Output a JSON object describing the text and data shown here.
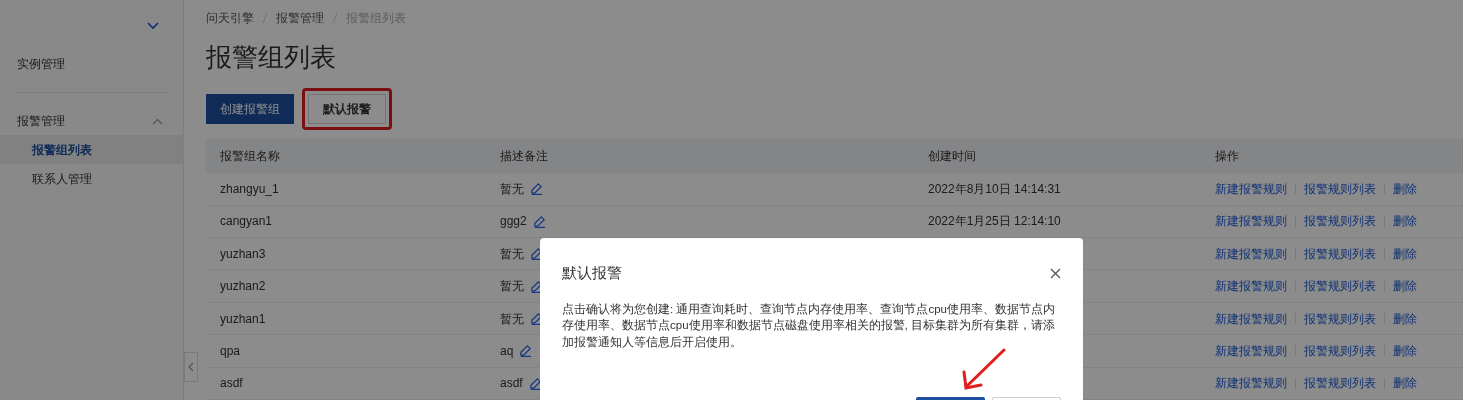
{
  "sidebar": {
    "items": [
      {
        "label": "实例管理",
        "kind": "item",
        "selected": false
      },
      {
        "label": "报警管理",
        "kind": "group",
        "expanded": true,
        "children": [
          {
            "label": "报警组列表",
            "selected": true
          },
          {
            "label": "联系人管理",
            "selected": false
          }
        ]
      }
    ]
  },
  "breadcrumb": [
    "问天引擎",
    "报警管理",
    "报警组列表"
  ],
  "page_title": "报警组列表",
  "toolbar": [
    {
      "label": "创建报警组",
      "kind": "primary",
      "highlighted": false
    },
    {
      "label": "默认报警",
      "kind": "default",
      "highlighted": true
    }
  ],
  "table": {
    "columns": [
      "报警组名称",
      "描述备注",
      "创建时间",
      "操作"
    ],
    "rows": [
      {
        "name": "zhangyu_1",
        "description": "暂无",
        "created": "2022年8月10日 14:14:31",
        "actions": [
          "新建报警规则",
          "报警规则列表",
          "删除"
        ]
      },
      {
        "name": "cangyan1",
        "description": "ggg2",
        "created": "2022年1月25日 12:14:10",
        "actions": [
          "新建报警规则",
          "报警规则列表",
          "删除"
        ]
      },
      {
        "name": "yuzhan3",
        "description": "暂无",
        "actions": [
          "新建报警规则",
          "报警规则列表",
          "删除"
        ]
      },
      {
        "name": "yuzhan2",
        "description": "暂无",
        "actions": [
          "新建报警规则",
          "报警规则列表",
          "删除"
        ]
      },
      {
        "name": "yuzhan1",
        "description": "暂无",
        "actions": [
          "新建报警规则",
          "报警规则列表",
          "删除"
        ]
      },
      {
        "name": "qpa",
        "description": "aq",
        "actions": [
          "新建报警规则",
          "报警规则列表",
          "删除"
        ]
      },
      {
        "name": "asdf",
        "description": "asdf",
        "actions": [
          "新建报警规则",
          "报警规则列表",
          "删除"
        ]
      }
    ]
  },
  "dialog": {
    "title": "默认报警",
    "body": "点击确认将为您创建: 通用查询耗时、查询节点内存使用率、查询节点cpu使用率、数据节点内存使用率、数据节点cpu使用率和数据节点磁盘使用率相关的报警, 目标集群为所有集群，请添加报警通知人等信息后开启使用。",
    "buttons": [
      {
        "kind": "primary"
      },
      {
        "kind": "default"
      }
    ]
  }
}
